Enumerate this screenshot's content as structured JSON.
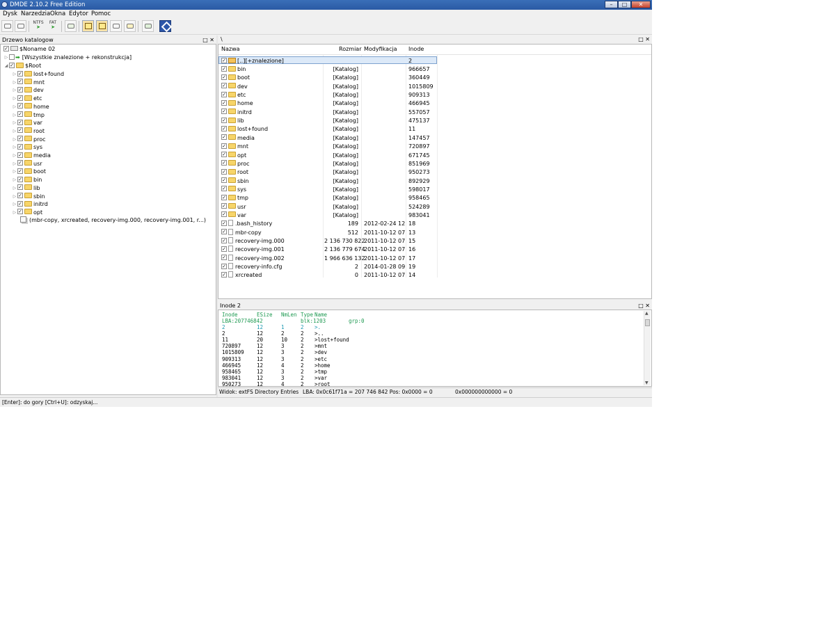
{
  "window": {
    "title": "DMDE 2.10.2 Free Edition",
    "controls": {
      "minimize": "–",
      "maximize": "□",
      "close": "✕"
    }
  },
  "menu": [
    "Dysk",
    "Narzedzia",
    "Okna",
    "Edytor",
    "Pomoc"
  ],
  "toolbar": {
    "ntfs_label": "NTFS",
    "fat_label": "FAT"
  },
  "tree_panel": {
    "title": "Drzewo katalogow",
    "buttons": "□ ✕",
    "root_item": "$Noname 02",
    "all_found": "[Wszystkie znalezione + rekonstrukcja]",
    "root_folder": "$Root",
    "folders": [
      "lost+found",
      "mnt",
      "dev",
      "etc",
      "home",
      "tmp",
      "var",
      "root",
      "proc",
      "sys",
      "media",
      "usr",
      "boot",
      "bin",
      "lib",
      "sbin",
      "initrd",
      "opt"
    ],
    "files_summary": "(mbr-copy, xrcreated, recovery-img.000, recovery-img.001, r...)"
  },
  "list_panel": {
    "path": "\\",
    "buttons": "□ ✕",
    "columns": {
      "name": "Nazwa",
      "size": "Rozmiar",
      "modified": "Modyfikacja",
      "inode": "Inode"
    },
    "parent_row": {
      "name": "[..][+znalezione]",
      "inode": "2"
    },
    "rows": [
      {
        "name": "bin",
        "size": "[Katalog]",
        "modified": "",
        "inode": "966657",
        "type": "dir"
      },
      {
        "name": "boot",
        "size": "[Katalog]",
        "modified": "",
        "inode": "360449",
        "type": "dir"
      },
      {
        "name": "dev",
        "size": "[Katalog]",
        "modified": "",
        "inode": "1015809",
        "type": "dir"
      },
      {
        "name": "etc",
        "size": "[Katalog]",
        "modified": "",
        "inode": "909313",
        "type": "dir"
      },
      {
        "name": "home",
        "size": "[Katalog]",
        "modified": "",
        "inode": "466945",
        "type": "dir"
      },
      {
        "name": "initrd",
        "size": "[Katalog]",
        "modified": "",
        "inode": "557057",
        "type": "dir"
      },
      {
        "name": "lib",
        "size": "[Katalog]",
        "modified": "",
        "inode": "475137",
        "type": "dir"
      },
      {
        "name": "lost+found",
        "size": "[Katalog]",
        "modified": "",
        "inode": "11",
        "type": "dir"
      },
      {
        "name": "media",
        "size": "[Katalog]",
        "modified": "",
        "inode": "147457",
        "type": "dir"
      },
      {
        "name": "mnt",
        "size": "[Katalog]",
        "modified": "",
        "inode": "720897",
        "type": "dir"
      },
      {
        "name": "opt",
        "size": "[Katalog]",
        "modified": "",
        "inode": "671745",
        "type": "dir"
      },
      {
        "name": "proc",
        "size": "[Katalog]",
        "modified": "",
        "inode": "851969",
        "type": "dir"
      },
      {
        "name": "root",
        "size": "[Katalog]",
        "modified": "",
        "inode": "950273",
        "type": "dir"
      },
      {
        "name": "sbin",
        "size": "[Katalog]",
        "modified": "",
        "inode": "892929",
        "type": "dir"
      },
      {
        "name": "sys",
        "size": "[Katalog]",
        "modified": "",
        "inode": "598017",
        "type": "dir"
      },
      {
        "name": "tmp",
        "size": "[Katalog]",
        "modified": "",
        "inode": "958465",
        "type": "dir"
      },
      {
        "name": "usr",
        "size": "[Katalog]",
        "modified": "",
        "inode": "524289",
        "type": "dir"
      },
      {
        "name": "var",
        "size": "[Katalog]",
        "modified": "",
        "inode": "983041",
        "type": "dir"
      },
      {
        "name": ".bash_history",
        "size": "189",
        "modified": "2012-02-24 12:...",
        "inode": "18",
        "type": "file"
      },
      {
        "name": "mbr-copy",
        "size": "512",
        "modified": "2011-10-12 07:...",
        "inode": "13",
        "type": "file"
      },
      {
        "name": "recovery-img.000",
        "size": "2 136 730 822",
        "modified": "2011-10-12 07:...",
        "inode": "15",
        "type": "file"
      },
      {
        "name": "recovery-img.001",
        "size": "2 136 779 674",
        "modified": "2011-10-12 07:...",
        "inode": "16",
        "type": "file"
      },
      {
        "name": "recovery-img.002",
        "size": "1 966 636 132",
        "modified": "2011-10-12 07:...",
        "inode": "17",
        "type": "file"
      },
      {
        "name": "recovery-info.cfg",
        "size": "2",
        "modified": "2014-01-28 09:...",
        "inode": "19",
        "type": "file"
      },
      {
        "name": "xrcreated",
        "size": "0",
        "modified": "2011-10-12 07:...",
        "inode": "14",
        "type": "file"
      }
    ]
  },
  "inode_panel": {
    "title": "Inode 2",
    "buttons": "□ ✕",
    "header": [
      "Inode",
      "ESize",
      "NmLen",
      "Type",
      "Name"
    ],
    "lba_line": {
      "lba": "LBA:207746842",
      "blk": "blk:1203",
      "grp": "grp:0"
    },
    "rows": [
      [
        "2",
        "12",
        "1",
        "2",
        ">."
      ],
      [
        "2",
        "12",
        "2",
        "2",
        ">.."
      ],
      [
        "11",
        "20",
        "10",
        "2",
        ">lost+found"
      ],
      [
        "720897",
        "12",
        "3",
        "2",
        ">mnt"
      ],
      [
        "1015809",
        "12",
        "3",
        "2",
        ">dev"
      ],
      [
        "909313",
        "12",
        "3",
        "2",
        ">etc"
      ],
      [
        "466945",
        "12",
        "4",
        "2",
        ">home"
      ],
      [
        "958465",
        "12",
        "3",
        "2",
        ">tmp"
      ],
      [
        "983041",
        "12",
        "3",
        "2",
        ">var"
      ],
      [
        "950273",
        "12",
        "4",
        "2",
        ">root"
      ]
    ],
    "info": {
      "view": "Widok: extFS Directory Entries",
      "lba": "LBA: 0x0c61f71a = 207 746 842  Pos: 0x0000 = 0",
      "value": "0x000000000000 = 0"
    }
  },
  "status": "[Enter]: do gory  [Ctrl+U]: odzyskaj...",
  "colors": {
    "titlebar": "#2a5aa4",
    "selection": "#dce9f8",
    "folder": "#f7d56a",
    "hex_green": "#1f9a52",
    "hex_cyan": "#1a98b0"
  }
}
